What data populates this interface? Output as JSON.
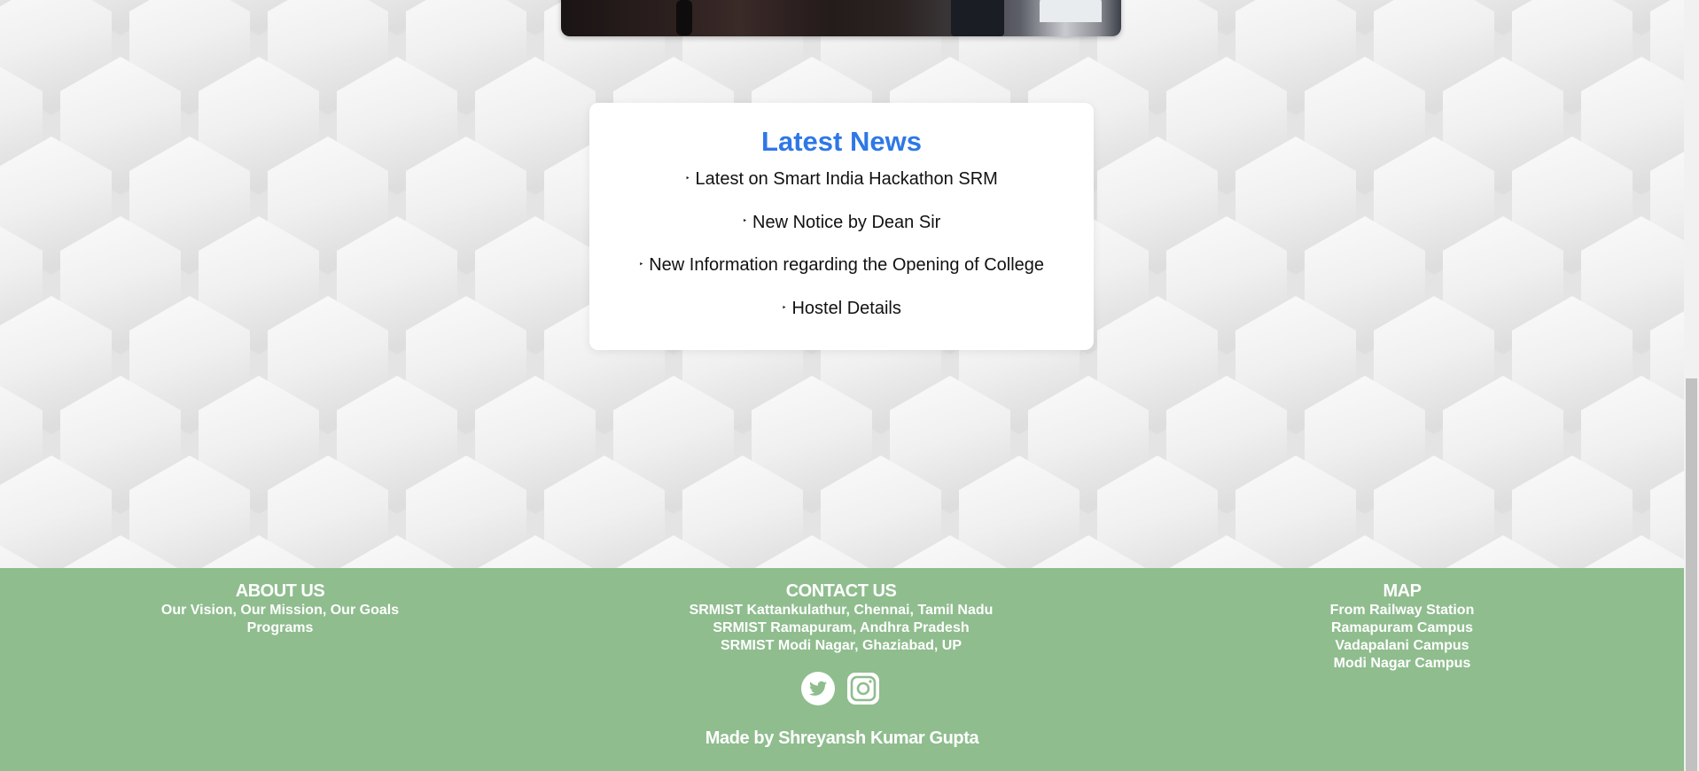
{
  "news": {
    "title": "Latest News",
    "bullet": "‣",
    "items": [
      "Latest on Smart India Hackathon SRM",
      "New Notice by Dean Sir",
      "New Information regarding the Opening of College",
      "Hostel Details"
    ]
  },
  "footer": {
    "about": {
      "heading": "ABOUT US",
      "links": [
        "Our Vision, Our Mission, Our Goals",
        "Programs"
      ]
    },
    "contact": {
      "heading": "CONTACT US",
      "links": [
        "SRMIST Kattankulathur, Chennai, Tamil Nadu",
        "SRMIST Ramapuram, Andhra Pradesh",
        "SRMIST Modi Nagar, Ghaziabad, UP"
      ]
    },
    "map": {
      "heading": "MAP",
      "links": [
        "From Railway Station",
        "Ramapuram Campus",
        "Vadapalani Campus",
        "Modi Nagar Campus"
      ]
    },
    "social": [
      "twitter-icon",
      "instagram-icon"
    ],
    "credit": "Made by Shreyansh Kumar Gupta"
  },
  "colors": {
    "footer_bg": "#8fbd8e",
    "news_title": "#2e78e6",
    "page_bg": "#eeeeee"
  }
}
